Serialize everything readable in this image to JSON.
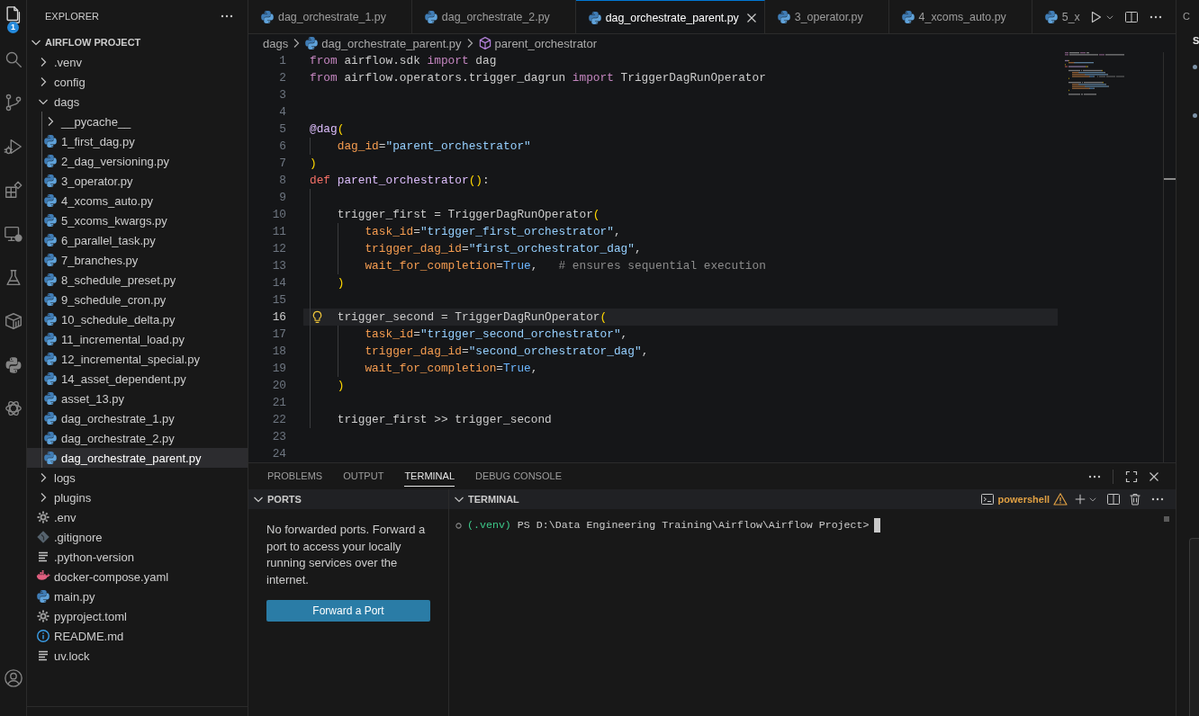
{
  "activity_bar": {
    "items": [
      {
        "kind": "files",
        "selected": true,
        "badge": "1"
      },
      {
        "kind": "search",
        "selected": false
      },
      {
        "kind": "source-control",
        "selected": false
      },
      {
        "kind": "run-debug",
        "selected": false
      },
      {
        "kind": "extensions",
        "selected": false
      },
      {
        "kind": "remote",
        "selected": false
      },
      {
        "kind": "testing",
        "selected": false
      },
      {
        "kind": "containers",
        "selected": false
      },
      {
        "kind": "python",
        "selected": false
      },
      {
        "kind": "knot",
        "selected": false
      }
    ],
    "bottom_items": [
      {
        "kind": "account",
        "selected": false
      }
    ]
  },
  "explorer": {
    "title": "EXPLORER",
    "project": {
      "title": "AIRFLOW PROJECT",
      "expanded": true,
      "children": [
        {
          "label": ".venv",
          "kind": "folder",
          "expanded": false,
          "selected": false
        },
        {
          "label": "config",
          "kind": "folder",
          "expanded": false,
          "selected": false
        },
        {
          "label": "dags",
          "kind": "folder",
          "expanded": true,
          "selected": false,
          "children": [
            {
              "label": "__pycache__",
              "kind": "folder",
              "expanded": false,
              "selected": false
            },
            {
              "label": "1_first_dag.py",
              "kind": "python",
              "selected": false
            },
            {
              "label": "2_dag_versioning.py",
              "kind": "python",
              "selected": false
            },
            {
              "label": "3_operator.py",
              "kind": "python",
              "selected": false
            },
            {
              "label": "4_xcoms_auto.py",
              "kind": "python",
              "selected": false
            },
            {
              "label": "5_xcoms_kwargs.py",
              "kind": "python",
              "selected": false
            },
            {
              "label": "6_parallel_task.py",
              "kind": "python",
              "selected": false
            },
            {
              "label": "7_branches.py",
              "kind": "python",
              "selected": false
            },
            {
              "label": "8_schedule_preset.py",
              "kind": "python",
              "selected": false
            },
            {
              "label": "9_schedule_cron.py",
              "kind": "python",
              "selected": false
            },
            {
              "label": "10_schedule_delta.py",
              "kind": "python",
              "selected": false
            },
            {
              "label": "11_incremental_load.py",
              "kind": "python",
              "selected": false
            },
            {
              "label": "12_incremental_special.py",
              "kind": "python",
              "selected": false
            },
            {
              "label": "14_asset_dependent.py",
              "kind": "python",
              "selected": false
            },
            {
              "label": "asset_13.py",
              "kind": "python",
              "selected": false
            },
            {
              "label": "dag_orchestrate_1.py",
              "kind": "python",
              "selected": false
            },
            {
              "label": "dag_orchestrate_2.py",
              "kind": "python",
              "selected": false
            },
            {
              "label": "dag_orchestrate_parent.py",
              "kind": "python",
              "selected": true
            }
          ]
        },
        {
          "label": "logs",
          "kind": "folder",
          "expanded": false,
          "selected": false
        },
        {
          "label": "plugins",
          "kind": "folder",
          "expanded": false,
          "selected": false
        },
        {
          "label": ".env",
          "kind": "settings",
          "selected": false
        },
        {
          "label": ".gitignore",
          "kind": "git",
          "selected": false
        },
        {
          "label": ".python-version",
          "kind": "text",
          "selected": false
        },
        {
          "label": "docker-compose.yaml",
          "kind": "docker",
          "selected": false
        },
        {
          "label": "main.py",
          "kind": "python",
          "selected": false
        },
        {
          "label": "pyproject.toml",
          "kind": "settings",
          "selected": false
        },
        {
          "label": "README.md",
          "kind": "info",
          "selected": false
        },
        {
          "label": "uv.lock",
          "kind": "text",
          "selected": false
        }
      ]
    }
  },
  "tabs": [
    {
      "label": "dag_orchestrate_1.py",
      "selected": false
    },
    {
      "label": "dag_orchestrate_2.py",
      "selected": false
    },
    {
      "label": "dag_orchestrate_parent.py",
      "selected": true
    },
    {
      "label": "3_operator.py",
      "selected": false
    },
    {
      "label": "4_xcoms_auto.py",
      "selected": false
    },
    {
      "label": "5_x",
      "selected": false
    }
  ],
  "breadcrumbs": [
    {
      "label": "dags",
      "kind": "folder"
    },
    {
      "label": "dag_orchestrate_parent.py",
      "kind": "python"
    },
    {
      "label": "parent_orchestrator",
      "kind": "symbol"
    }
  ],
  "editor": {
    "lines": [
      {
        "number": "1",
        "current": false,
        "tokens": [
          {
            "text": "from",
            "kind": "keyword"
          },
          {
            "text": " airflow.sdk ",
            "kind": "plain"
          },
          {
            "text": "import",
            "kind": "keyword"
          },
          {
            "text": " dag",
            "kind": "plain"
          }
        ]
      },
      {
        "number": "2",
        "current": false,
        "tokens": [
          {
            "text": "from",
            "kind": "keyword"
          },
          {
            "text": " airflow.operators.trigger_dagrun ",
            "kind": "plain"
          },
          {
            "text": "import",
            "kind": "keyword"
          },
          {
            "text": " TriggerDagRunOperator",
            "kind": "plain"
          }
        ]
      },
      {
        "number": "3",
        "current": false
      },
      {
        "number": "4",
        "current": false
      },
      {
        "number": "5",
        "current": false,
        "tokens": [
          {
            "text": "@dag",
            "kind": "decorator"
          },
          {
            "text": "(",
            "kind": "bracket"
          }
        ]
      },
      {
        "number": "6",
        "current": false,
        "tokens": [
          {
            "text": "    dag_id",
            "kind": "param"
          },
          {
            "text": "=",
            "kind": "plain"
          },
          {
            "text": "\"parent_orchestrator\"",
            "kind": "string"
          }
        ]
      },
      {
        "number": "7",
        "current": false,
        "tokens": [
          {
            "text": ")",
            "kind": "bracket"
          }
        ]
      },
      {
        "number": "8",
        "current": false,
        "tokens": [
          {
            "text": "def",
            "kind": "storage"
          },
          {
            "text": " parent_orchestrator",
            "kind": "function"
          },
          {
            "text": "()",
            "kind": "bracket"
          },
          {
            "text": ":",
            "kind": "plain"
          }
        ]
      },
      {
        "number": "9",
        "current": false
      },
      {
        "number": "10",
        "current": false,
        "tokens": [
          {
            "text": "    trigger_first = TriggerDagRunOperator",
            "kind": "plain"
          },
          {
            "text": "(",
            "kind": "bracket"
          }
        ]
      },
      {
        "number": "11",
        "current": false,
        "tokens": [
          {
            "text": "        task_id",
            "kind": "param"
          },
          {
            "text": "=",
            "kind": "plain"
          },
          {
            "text": "\"trigger_first_orchestrator\"",
            "kind": "string"
          },
          {
            "text": ",",
            "kind": "plain"
          }
        ]
      },
      {
        "number": "12",
        "current": false,
        "tokens": [
          {
            "text": "        trigger_dag_id",
            "kind": "param"
          },
          {
            "text": "=",
            "kind": "plain"
          },
          {
            "text": "\"first_orchestrator_dag\"",
            "kind": "string"
          },
          {
            "text": ",",
            "kind": "plain"
          }
        ]
      },
      {
        "number": "13",
        "current": false,
        "tokens": [
          {
            "text": "        wait_for_completion",
            "kind": "param"
          },
          {
            "text": "=",
            "kind": "plain"
          },
          {
            "text": "True",
            "kind": "constant"
          },
          {
            "text": ",",
            "kind": "plain"
          },
          {
            "text": "   # ensures sequential execution",
            "kind": "comment"
          }
        ]
      },
      {
        "number": "14",
        "current": false,
        "tokens": [
          {
            "text": "    )",
            "kind": "bracket"
          }
        ]
      },
      {
        "number": "15",
        "current": false
      },
      {
        "number": "16",
        "current": true,
        "tokens": [
          {
            "text": "    trigger_second = TriggerDagRunOperator",
            "kind": "plain"
          },
          {
            "text": "(",
            "kind": "bracket"
          }
        ]
      },
      {
        "number": "17",
        "current": false,
        "tokens": [
          {
            "text": "        task_id",
            "kind": "param"
          },
          {
            "text": "=",
            "kind": "plain"
          },
          {
            "text": "\"trigger_second_orchestrator\"",
            "kind": "string"
          },
          {
            "text": ",",
            "kind": "plain"
          }
        ]
      },
      {
        "number": "18",
        "current": false,
        "tokens": [
          {
            "text": "        trigger_dag_id",
            "kind": "param"
          },
          {
            "text": "=",
            "kind": "plain"
          },
          {
            "text": "\"second_orchestrator_dag\"",
            "kind": "string"
          },
          {
            "text": ",",
            "kind": "plain"
          }
        ]
      },
      {
        "number": "19",
        "current": false,
        "tokens": [
          {
            "text": "        wait_for_completion",
            "kind": "param"
          },
          {
            "text": "=",
            "kind": "plain"
          },
          {
            "text": "True",
            "kind": "constant"
          },
          {
            "text": ",",
            "kind": "plain"
          }
        ]
      },
      {
        "number": "20",
        "current": false,
        "tokens": [
          {
            "text": "    )",
            "kind": "bracket"
          }
        ]
      },
      {
        "number": "21",
        "current": false
      },
      {
        "number": "22",
        "current": false,
        "tokens": [
          {
            "text": "    trigger_first >> trigger_second",
            "kind": "plain"
          }
        ]
      },
      {
        "number": "23",
        "current": false
      },
      {
        "number": "24",
        "current": false
      }
    ]
  },
  "panel": {
    "tabs": [
      {
        "label": "PROBLEMS",
        "selected": false
      },
      {
        "label": "OUTPUT",
        "selected": false
      },
      {
        "label": "TERMINAL",
        "selected": true
      },
      {
        "label": "DEBUG CONSOLE",
        "selected": false
      }
    ],
    "ports": {
      "title": "PORTS",
      "expanded": true,
      "message": "No forwarded ports. Forward a port to access your locally running services over the internet.",
      "button": "Forward a Port"
    },
    "terminal": {
      "title": "TERMINAL",
      "expanded": true,
      "shell": "powershell",
      "warning": true,
      "prompt": [
        {
          "text": "(.venv)",
          "kind": "env"
        },
        {
          "text": " PS D:\\Data Engineering Training\\Airflow\\Airflow Project>",
          "kind": "plain"
        }
      ]
    }
  },
  "secondary_sidebar": {
    "title": "C",
    "heading": "S"
  }
}
